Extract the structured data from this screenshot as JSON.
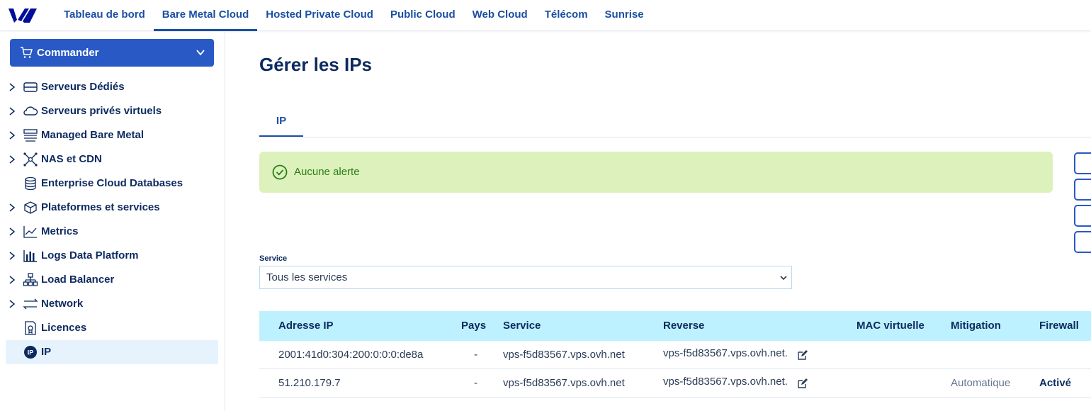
{
  "topbar": {
    "logo_icon": "ovhcloud-logo",
    "nav": [
      {
        "label": "Tableau de bord"
      },
      {
        "label": "Bare Metal Cloud"
      },
      {
        "label": "Hosted Private Cloud"
      },
      {
        "label": "Public Cloud"
      },
      {
        "label": "Web Cloud"
      },
      {
        "label": "Télécom"
      },
      {
        "label": "Sunrise"
      }
    ],
    "active_index": 1
  },
  "sidebar": {
    "order_button": {
      "label": "Commander",
      "icon": "cart-icon"
    },
    "items": [
      {
        "label": "Serveurs Dédiés",
        "icon": "server-icon",
        "expandable": true
      },
      {
        "label": "Serveurs privés virtuels",
        "icon": "cloud-icon",
        "expandable": true
      },
      {
        "label": "Managed Bare Metal",
        "icon": "stack-icon",
        "expandable": true
      },
      {
        "label": "NAS et CDN",
        "icon": "network-nodes-icon",
        "expandable": true
      },
      {
        "label": "Enterprise Cloud Databases",
        "icon": "database-icon",
        "expandable": false
      },
      {
        "label": "Plateformes et services",
        "icon": "cube-icon",
        "expandable": true
      },
      {
        "label": "Metrics",
        "icon": "line-chart-icon",
        "expandable": true
      },
      {
        "label": "Logs Data Platform",
        "icon": "bar-chart-icon",
        "expandable": true
      },
      {
        "label": "Load Balancer",
        "icon": "hierarchy-icon",
        "expandable": true
      },
      {
        "label": "Network",
        "icon": "arrows-icon",
        "expandable": true
      },
      {
        "label": "Licences",
        "icon": "license-icon",
        "expandable": false
      },
      {
        "label": "IP",
        "icon": "ip-icon",
        "expandable": false
      }
    ],
    "active_label": "IP"
  },
  "main": {
    "title": "Gérer les IPs",
    "tabs": [
      {
        "label": "IP"
      }
    ],
    "alert": {
      "message": "Aucune alerte",
      "icon": "check-circle-icon"
    },
    "service_filter": {
      "label": "Service",
      "value": "Tous les services"
    },
    "table": {
      "headers": [
        "Adresse IP",
        "Pays",
        "Service",
        "Reverse",
        "MAC virtuelle",
        "Mitigation",
        "Firewall"
      ],
      "rows": [
        {
          "ip": "2001:41d0:304:200:0:0:0:de8a",
          "country": "-",
          "service": "vps-f5d83567.vps.ovh.net",
          "reverse": "vps-f5d83567.vps.ovh.net.",
          "mac": "",
          "mitigation": "",
          "firewall": ""
        },
        {
          "ip": "51.210.179.7",
          "country": "-",
          "service": "vps-f5d83567.vps.ovh.net",
          "reverse": "vps-f5d83567.vps.ovh.net.",
          "mac": "",
          "mitigation": "Automatique",
          "firewall": "Activé"
        }
      ]
    }
  },
  "colors": {
    "brand": "#2859c5",
    "nav_text": "#1a4fa3",
    "heading": "#0d2a5f",
    "alert_bg": "#dcf1bb",
    "alert_text": "#2c7d19",
    "table_header_bg": "#bef1ff",
    "active_item_bg": "#e6f3fd"
  }
}
